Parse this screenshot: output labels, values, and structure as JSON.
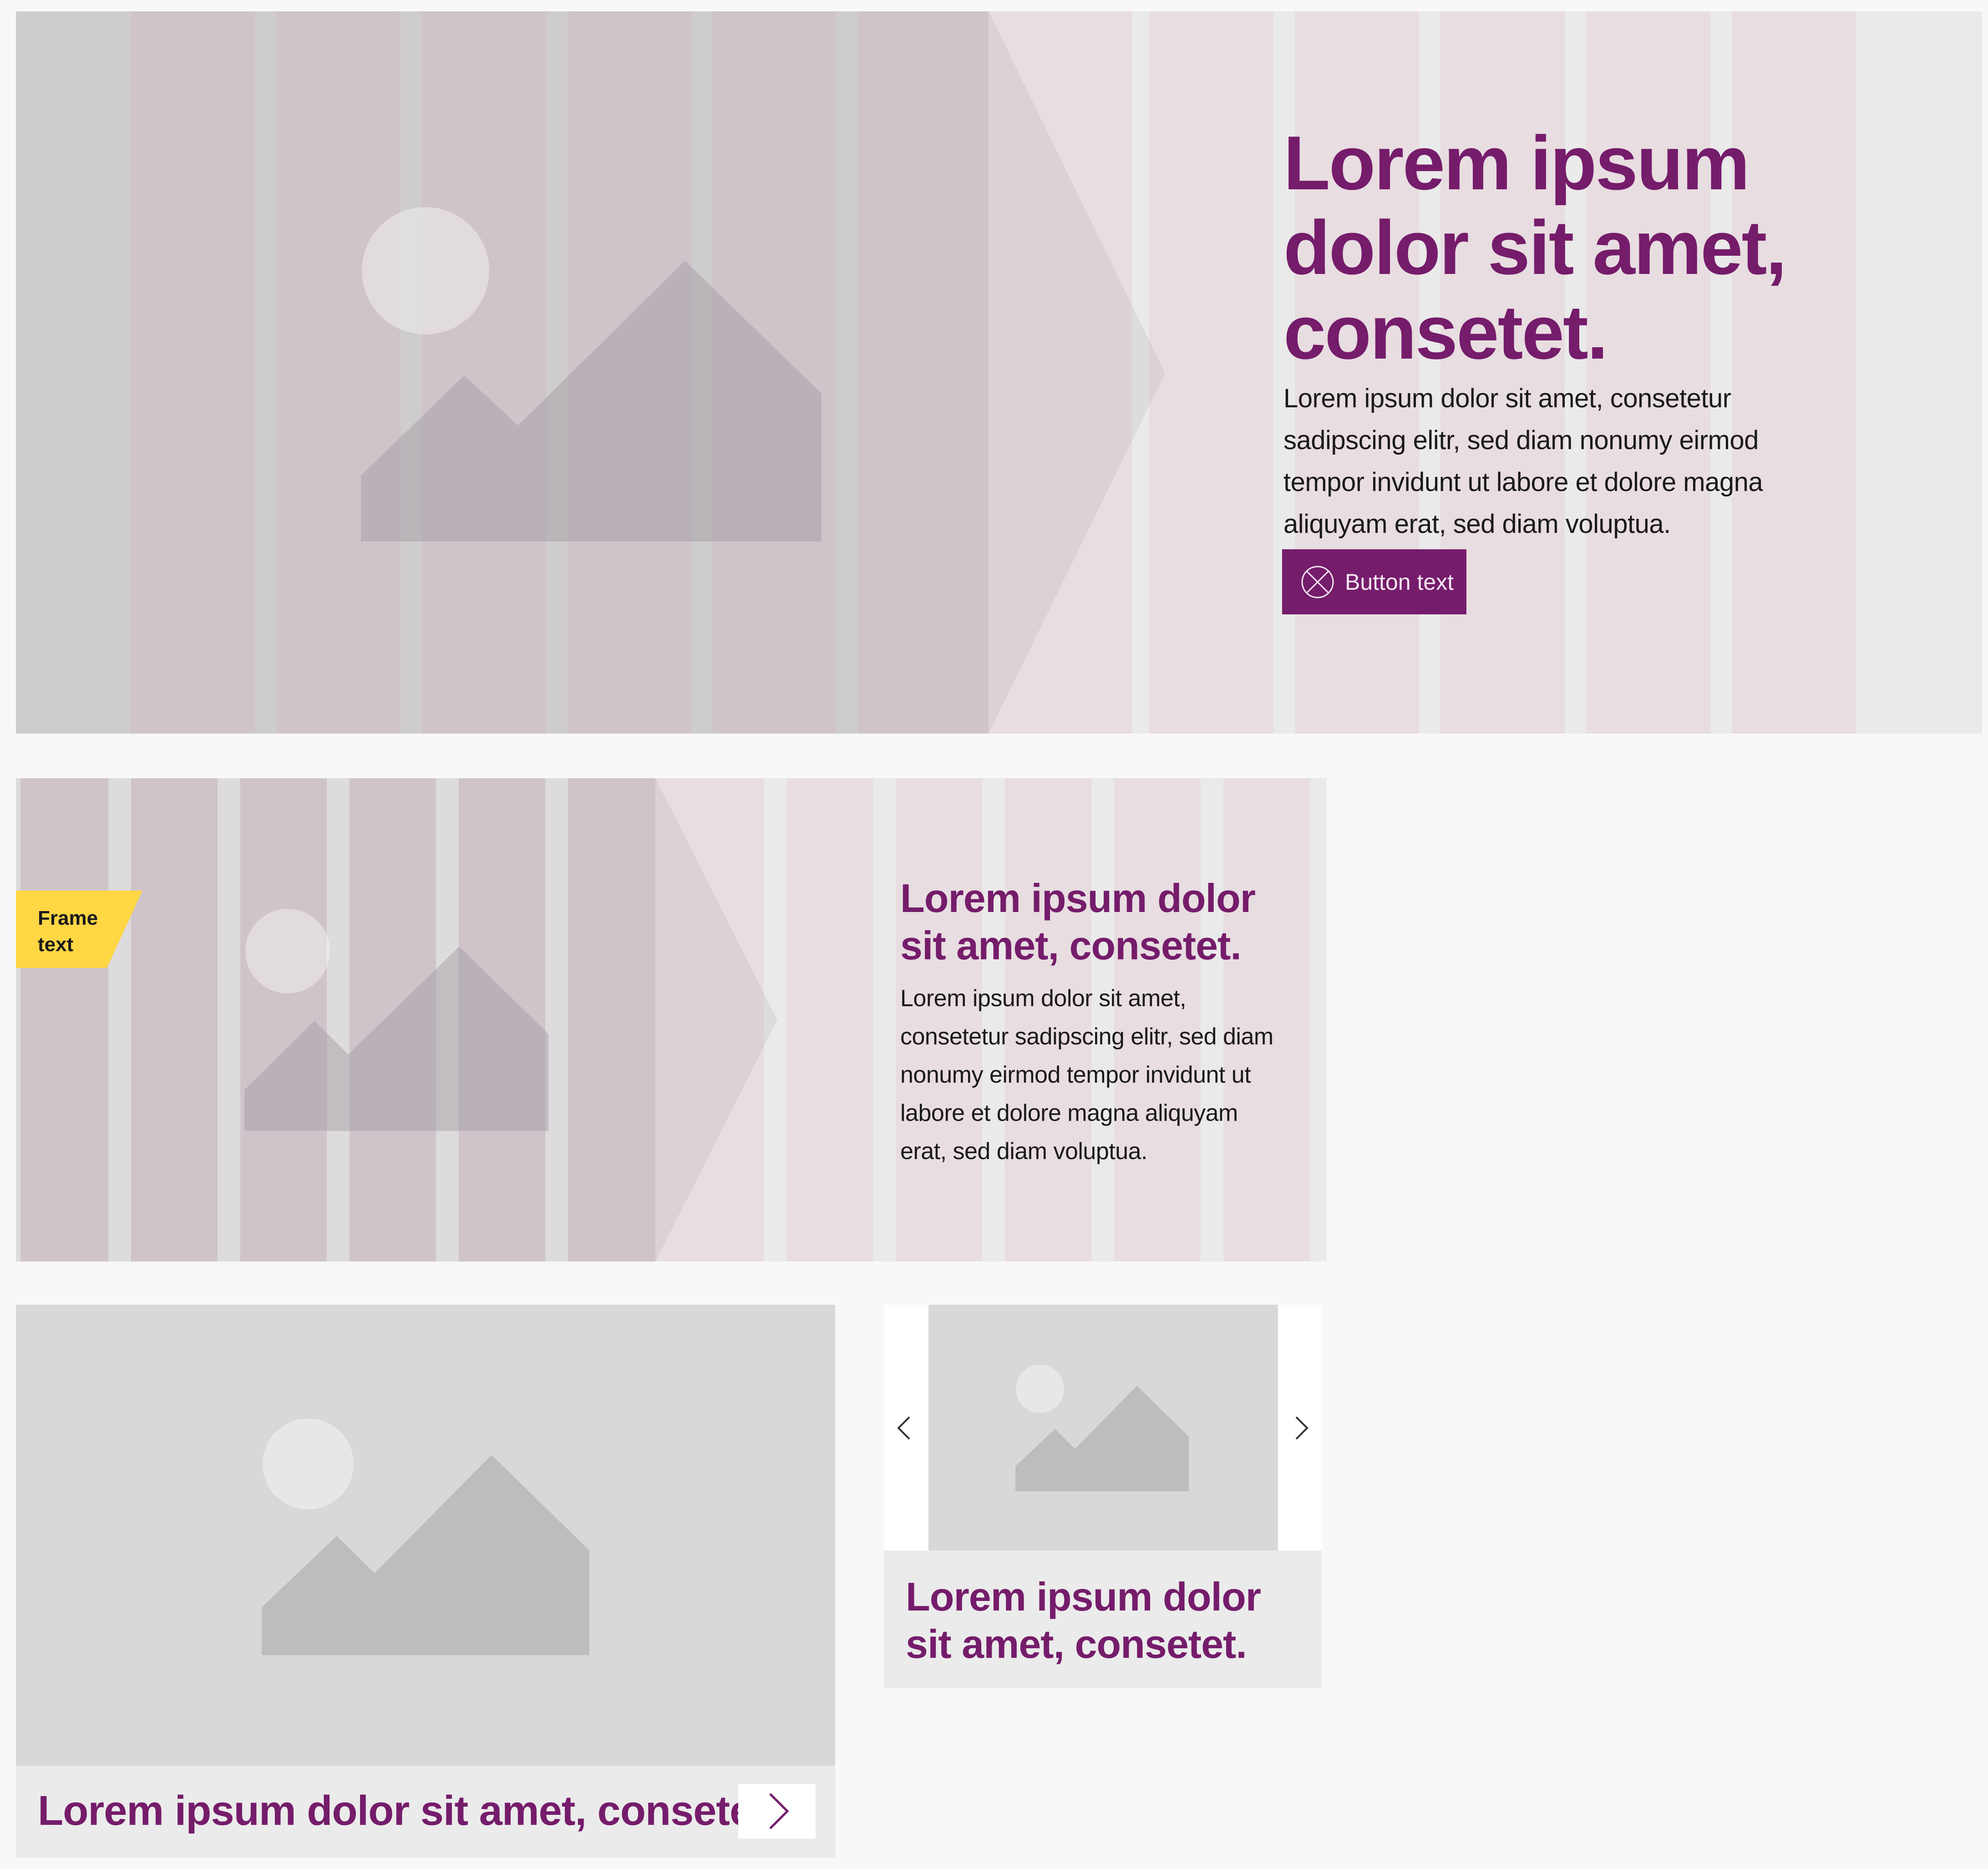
{
  "colors": {
    "page_background": "#f8f8f8",
    "accent_purple": "#751c6b",
    "frame_tag_yellow": "#ffd643",
    "placeholder_gray": "#d8d8d8",
    "grid_column_dark": "#d8ccd1",
    "grid_column_light": "#e8dde1"
  },
  "hero": {
    "title": "Lorem ipsum dolor sit amet, consetet.",
    "text": "Lorem ipsum dolor sit amet, consetetur sadipscing elitr, sed diam nonumy eirmod tempor invidunt ut labore et dolore magna aliquyam erat, sed diam voluptua.",
    "button": {
      "label": "Button text",
      "icon": "circle-x-icon"
    },
    "image_icon": "image-placeholder-icon"
  },
  "teaser": {
    "frame_text": "Frame text",
    "title": "Lorem ipsum dolor sit amet, consetet.",
    "text": "Lorem ipsum dolor sit amet, consetetur sadipscing elitr, sed diam nonumy eirmod tempor invidunt ut labore et dolore magna aliquyam erat, sed diam voluptua.",
    "image_icon": "image-placeholder-icon"
  },
  "card": {
    "title": "Lorem ipsum dolor sit amet, consetet.",
    "arrow_icon": "chevron-right-icon",
    "image_icon": "image-placeholder-icon"
  },
  "slider": {
    "title": "Lorem ipsum dolor sit amet, consetet.",
    "prev_icon": "chevron-left-icon",
    "next_icon": "chevron-right-icon",
    "image_icon": "image-placeholder-icon"
  }
}
